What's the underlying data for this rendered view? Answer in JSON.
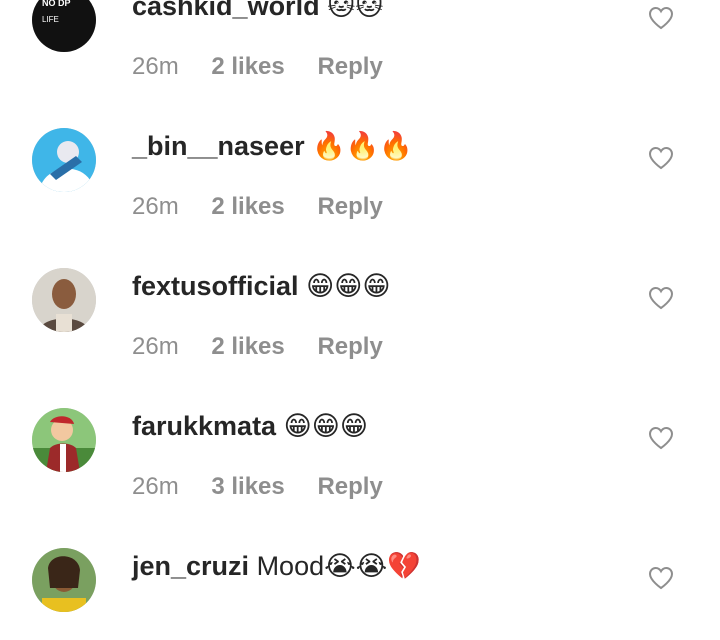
{
  "comments": [
    {
      "username": "cashkid_world",
      "text": "🐱🐱",
      "time": "26m",
      "likes": "2 likes",
      "reply": "Reply",
      "avatar_text": [
        "NO DP",
        "LIFE"
      ],
      "avatar_color": "#111111"
    },
    {
      "username": "_bin__naseer",
      "text": "🔥🔥🔥",
      "time": "26m",
      "likes": "2 likes",
      "reply": "Reply",
      "avatar_color": "#3fb6e8"
    },
    {
      "username": "fextusofficial",
      "text": "😁😁😁",
      "time": "26m",
      "likes": "2 likes",
      "reply": "Reply",
      "avatar_color": "#a89a8a"
    },
    {
      "username": "farukkmata",
      "text": "😁😁😁",
      "time": "26m",
      "likes": "3 likes",
      "reply": "Reply",
      "avatar_color": "#6fae5a"
    },
    {
      "username": "jen_cruzi",
      "text": "Mood😭😭💔",
      "time": "",
      "likes": "",
      "reply": "",
      "avatar_color": "#8a6a3a"
    }
  ],
  "colors": {
    "username": "#262626",
    "meta": "#8e8e8e",
    "heart": "#8e8e8e"
  }
}
